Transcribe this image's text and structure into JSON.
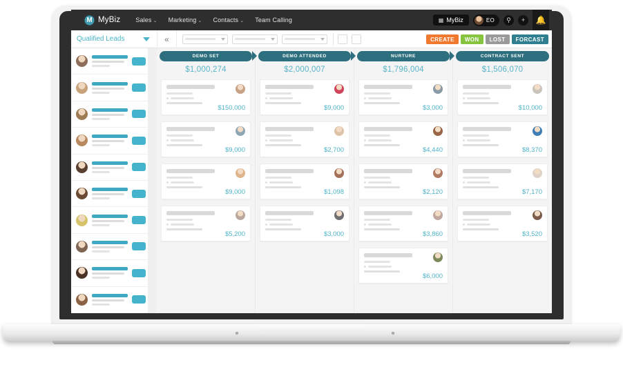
{
  "brand": {
    "name": "MyBiz",
    "logo_icon": "mybiz-logo-icon"
  },
  "nav": {
    "links": [
      {
        "label": "Sales",
        "caret": "⌄"
      },
      {
        "label": "Marketing",
        "caret": "⌄"
      },
      {
        "label": "Contacts",
        "caret": "⌄"
      },
      {
        "label": "Team Calling",
        "caret": ""
      }
    ],
    "app_switcher": {
      "icon": "grid-icon",
      "label": "MyBiz"
    },
    "user_chip": {
      "initials": "EO",
      "avatar_icon": "user-avatar"
    },
    "search_icon": "search-icon",
    "add_icon": "plus-icon",
    "notifications_icon": "bell-icon"
  },
  "subbar": {
    "view_name": "Qualified Leads",
    "view_caret_icon": "chevron-down-icon",
    "collapse_icon": "«",
    "filters": [
      {
        "name": "filter-1"
      },
      {
        "name": "filter-2"
      },
      {
        "name": "filter-3"
      }
    ],
    "square_buttons": [
      {
        "name": "view-grid-button"
      },
      {
        "name": "view-list-button"
      }
    ],
    "actions": [
      {
        "label": "CREATE",
        "color": "#f0792f"
      },
      {
        "label": "WON",
        "color": "#86c440"
      },
      {
        "label": "LOST",
        "color": "#9a9a9a"
      },
      {
        "label": "FORCAST",
        "color": "#2f7f90"
      }
    ]
  },
  "sidebar": {
    "leads": [
      {
        "avatar": "#8d6e5a"
      },
      {
        "avatar": "#c8a27a"
      },
      {
        "avatar": "#9c7b55"
      },
      {
        "avatar": "#b8895e"
      },
      {
        "avatar": "#5a4030"
      },
      {
        "avatar": "#6b4a33"
      },
      {
        "avatar": "#d6c36a"
      },
      {
        "avatar": "#7e6452"
      },
      {
        "avatar": "#4a3326"
      },
      {
        "avatar": "#8a6245"
      }
    ]
  },
  "board": {
    "columns": [
      {
        "stage": "DEMO SET",
        "total": "$1,000,274",
        "cards": [
          {
            "amount": "$150,000",
            "avatar": "#c7a183"
          },
          {
            "amount": "$9,000",
            "avatar": "#8fa6b4"
          },
          {
            "amount": "$9,000",
            "avatar": "#e0b48c"
          },
          {
            "amount": "$5,200",
            "avatar": "#b9a89b"
          }
        ]
      },
      {
        "stage": "DEMO ATTENDED",
        "total": "$2,000,007",
        "cards": [
          {
            "amount": "$9,000",
            "avatar": "#d0445c"
          },
          {
            "amount": "$2,700",
            "avatar": "#ddc3a8"
          },
          {
            "amount": "$1,098",
            "avatar": "#a3705a"
          },
          {
            "amount": "$3,000",
            "avatar": "#6f6f73"
          }
        ]
      },
      {
        "stage": "NURTURE",
        "total": "$1,796,004",
        "cards": [
          {
            "amount": "$3,000",
            "avatar": "#8a9aa6"
          },
          {
            "amount": "$4,440",
            "avatar": "#9a6647"
          },
          {
            "amount": "$2,120",
            "avatar": "#b07a63"
          },
          {
            "amount": "$3,860",
            "avatar": "#c2a9a0"
          },
          {
            "amount": "$6,000",
            "avatar": "#7d8a5c"
          }
        ]
      },
      {
        "stage": "CONTRACT SENT",
        "total": "$1,506,070",
        "cards": [
          {
            "amount": "$10,000",
            "avatar": "#c9c3bb"
          },
          {
            "amount": "$8,370",
            "avatar": "#3f7fb5"
          },
          {
            "amount": "$7,170",
            "avatar": "#ded3c6"
          },
          {
            "amount": "$3,520",
            "avatar": "#7b5c4b"
          }
        ]
      }
    ]
  }
}
